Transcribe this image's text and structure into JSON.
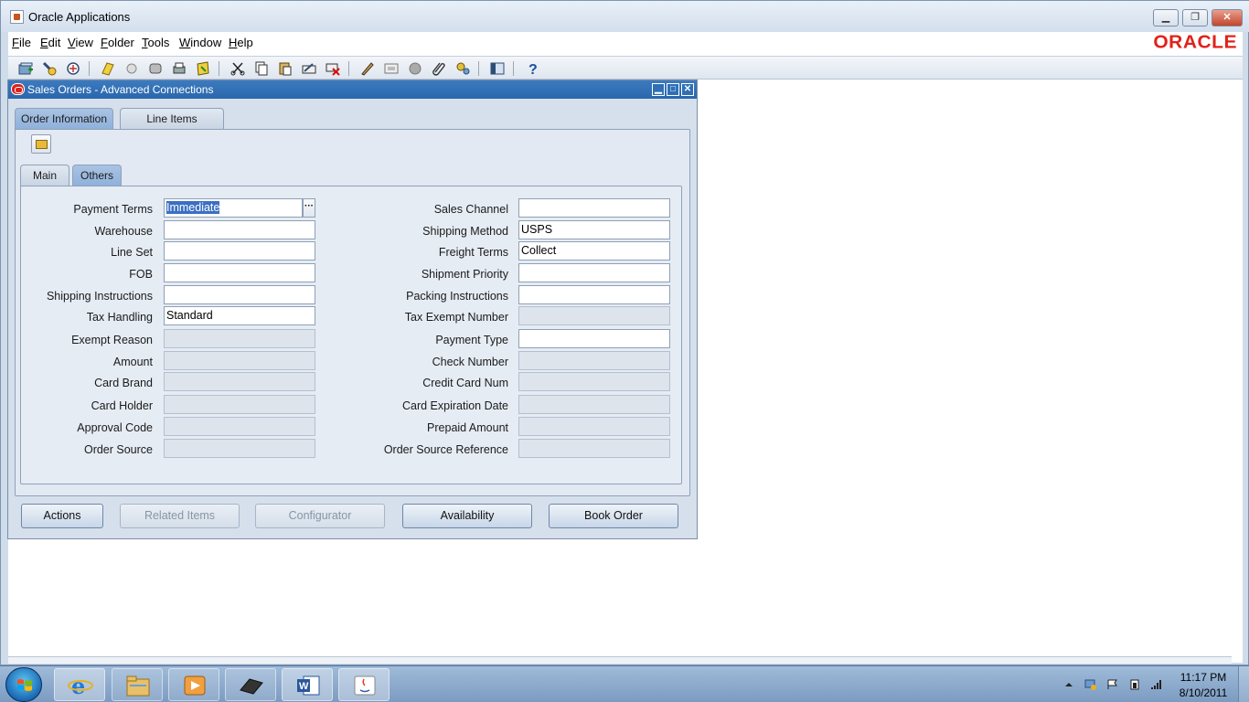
{
  "app": {
    "title": "Oracle Applications",
    "logo_text": "ORACLE",
    "menus": [
      {
        "label": "File",
        "ul": "F",
        "rest": "ile"
      },
      {
        "label": "Edit",
        "ul": "E",
        "rest": "dit"
      },
      {
        "label": "View",
        "ul": "V",
        "rest": "iew"
      },
      {
        "label": "Folder",
        "ul": "F",
        "rest": "older"
      },
      {
        "label": "Tools",
        "ul": "T",
        "rest": "ools"
      },
      {
        "label": "Window",
        "ul": "W",
        "rest": "indow"
      },
      {
        "label": "Help",
        "ul": "H",
        "rest": "elp"
      }
    ]
  },
  "form": {
    "title": "Sales Orders - Advanced Connections",
    "tabs": {
      "order_information": "Order Information",
      "line_items": "Line Items",
      "main": "Main",
      "others": "Others"
    },
    "left_fields": {
      "payment_terms": {
        "label": "Payment Terms",
        "value": "Immediate"
      },
      "warehouse": {
        "label": "Warehouse",
        "value": ""
      },
      "line_set": {
        "label": "Line Set",
        "value": ""
      },
      "fob": {
        "label": "FOB",
        "value": ""
      },
      "shipping_instructions": {
        "label": "Shipping Instructions",
        "value": ""
      },
      "tax_handling": {
        "label": "Tax Handling",
        "value": "Standard"
      },
      "exempt_reason": {
        "label": "Exempt Reason",
        "value": ""
      },
      "amount": {
        "label": "Amount",
        "value": ""
      },
      "card_brand": {
        "label": "Card Brand",
        "value": ""
      },
      "card_holder": {
        "label": "Card Holder",
        "value": ""
      },
      "approval_code": {
        "label": "Approval Code",
        "value": ""
      },
      "order_source": {
        "label": "Order Source",
        "value": ""
      }
    },
    "right_fields": {
      "sales_channel": {
        "label": "Sales Channel",
        "value": ""
      },
      "shipping_method": {
        "label": "Shipping Method",
        "value": "USPS"
      },
      "freight_terms": {
        "label": "Freight Terms",
        "value": "Collect"
      },
      "shipment_priority": {
        "label": "Shipment Priority",
        "value": ""
      },
      "packing_instructions": {
        "label": "Packing Instructions",
        "value": ""
      },
      "tax_exempt_number": {
        "label": "Tax Exempt Number",
        "value": ""
      },
      "payment_type": {
        "label": "Payment Type",
        "value": ""
      },
      "check_number": {
        "label": "Check Number",
        "value": ""
      },
      "credit_card_num": {
        "label": "Credit Card Num",
        "value": ""
      },
      "card_expiration_date": {
        "label": "Card Expiration Date",
        "value": ""
      },
      "prepaid_amount": {
        "label": "Prepaid Amount",
        "value": ""
      },
      "order_source_reference": {
        "label": "Order Source Reference",
        "value": ""
      }
    },
    "buttons": {
      "actions": "Actions",
      "related_items": "Related Items",
      "configurator": "Configurator",
      "availability": "Availability",
      "book_order": "Book Order"
    }
  },
  "taskbar": {
    "time": "11:17 PM",
    "date": "8/10/2011",
    "items": [
      "internet-explorer-icon",
      "windows-explorer-icon",
      "media-player-icon",
      "vaio-icon",
      "word-icon",
      "java-icon"
    ]
  },
  "colors": {
    "accent": "#2a66ac",
    "oracle_red": "#e0221a",
    "selection": "#3b6fc2"
  }
}
